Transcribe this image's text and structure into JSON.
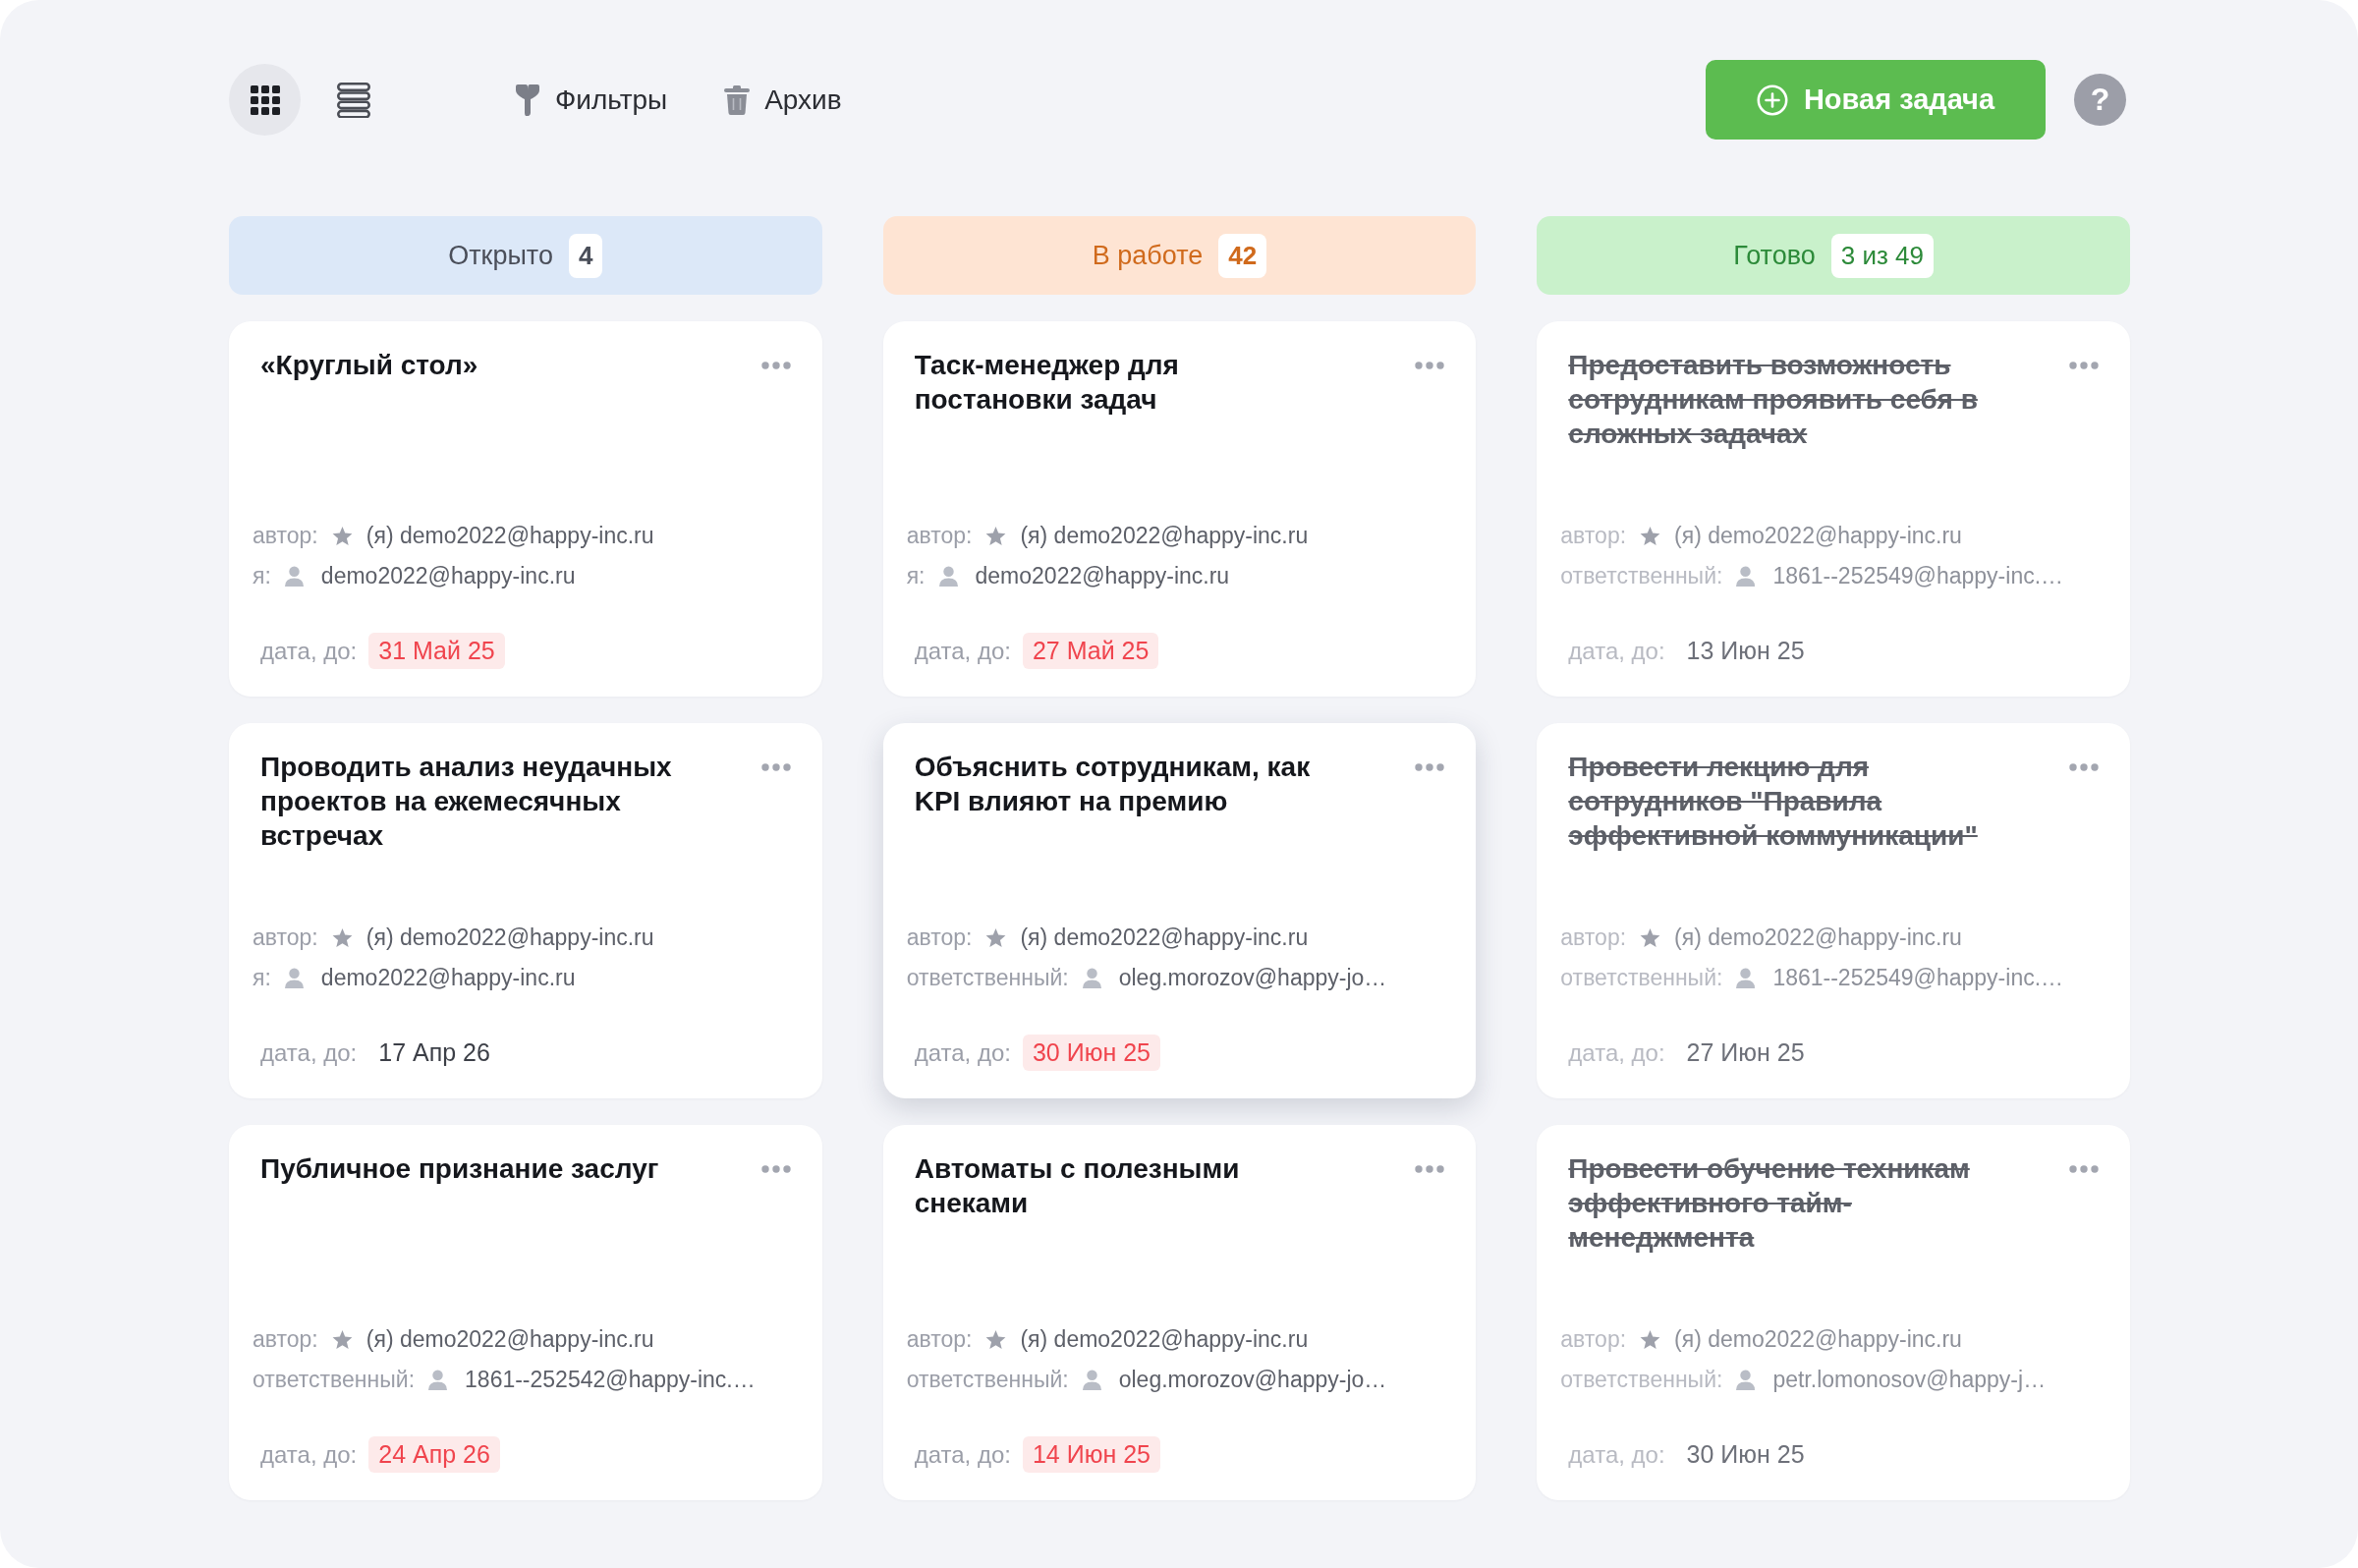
{
  "toolbar": {
    "views": [
      {
        "kind": "grid",
        "selected": true
      },
      {
        "kind": "list",
        "selected": false
      }
    ],
    "actions": [
      {
        "kind": "filter",
        "label": "Фильтры"
      },
      {
        "kind": "archive",
        "label": "Архив"
      }
    ],
    "new_task_button": {
      "label": "Новая задача"
    },
    "help_button": {
      "label": "?"
    }
  },
  "columns": [
    {
      "kind": "open",
      "title": "Открыто",
      "count": "4",
      "cards": [
        {
          "title": "«Круглый стол»",
          "completed": false,
          "hovered": false,
          "author_label": "автор:",
          "author": "(я) demo2022@happy-inc.ru",
          "assignee_label": "я:",
          "assignee": "demo2022@happy-inc.ru",
          "date_label": "дата, до:",
          "date": "31 Май 25",
          "overdue": true
        },
        {
          "title": "Проводить анализ неудачных проектов на ежемесячных встречах",
          "completed": false,
          "hovered": false,
          "author_label": "автор:",
          "author": "(я) demo2022@happy-inc.ru",
          "assignee_label": "я:",
          "assignee": "demo2022@happy-inc.ru",
          "date_label": "дата, до:",
          "date": "17 Апр 26",
          "overdue": false
        },
        {
          "title": "Публичное признание заслуг",
          "completed": false,
          "hovered": false,
          "author_label": "автор:",
          "author": "(я) demo2022@happy-inc.ru",
          "assignee_label": "ответственный:",
          "assignee": "1861--252542@happy-inc.…",
          "date_label": "дата, до:",
          "date": "24 Апр 26",
          "overdue": true
        }
      ]
    },
    {
      "kind": "progress",
      "title": "В работе",
      "count": "42",
      "cards": [
        {
          "title": "Таск-менеджер для постановки задач",
          "completed": false,
          "hovered": false,
          "author_label": "автор:",
          "author": "(я) demo2022@happy-inc.ru",
          "assignee_label": "я:",
          "assignee": "demo2022@happy-inc.ru",
          "date_label": "дата, до:",
          "date": "27 Май 25",
          "overdue": true
        },
        {
          "title": "Объяснить сотрудникам, как KPI влияют на премию",
          "completed": false,
          "hovered": true,
          "author_label": "автор:",
          "author": "(я) demo2022@happy-inc.ru",
          "assignee_label": "ответственный:",
          "assignee": "oleg.morozov@happy-jo…",
          "date_label": "дата, до:",
          "date": "30 Июн 25",
          "overdue": true
        },
        {
          "title": "Автоматы с полезными снеками",
          "completed": false,
          "hovered": false,
          "author_label": "автор:",
          "author": "(я) demo2022@happy-inc.ru",
          "assignee_label": "ответственный:",
          "assignee": "oleg.morozov@happy-jo…",
          "date_label": "дата, до:",
          "date": "14 Июн 25",
          "overdue": true
        }
      ]
    },
    {
      "kind": "done",
      "title": "Готово",
      "count": "3 из 49",
      "cards": [
        {
          "title": "Предоставить возможность сотрудникам проявить себя в сложных задачах",
          "completed": true,
          "hovered": false,
          "author_label": "автор:",
          "author": "(я) demo2022@happy-inc.ru",
          "assignee_label": "ответственный:",
          "assignee": "1861--252549@happy-inc.…",
          "date_label": "дата, до:",
          "date": "13 Июн 25",
          "overdue": false
        },
        {
          "title": "Провести лекцию для сотрудников \"Правила эффективной коммуникации\"",
          "completed": true,
          "hovered": false,
          "author_label": "автор:",
          "author": "(я) demo2022@happy-inc.ru",
          "assignee_label": "ответственный:",
          "assignee": "1861--252549@happy-inc.…",
          "date_label": "дата, до:",
          "date": "27 Июн 25",
          "overdue": false
        },
        {
          "title": "Провести обучение техникам эффективного тайм-менеджмента",
          "completed": true,
          "hovered": false,
          "author_label": "автор:",
          "author": "(я) demo2022@happy-inc.ru",
          "assignee_label": "ответственный:",
          "assignee": "petr.lomonosov@happy-j…",
          "date_label": "дата, до:",
          "date": "30 Июн 25",
          "overdue": false
        }
      ]
    }
  ]
}
